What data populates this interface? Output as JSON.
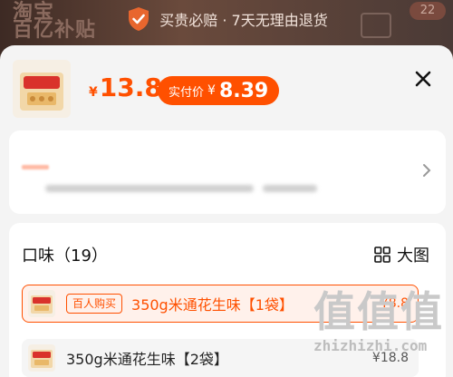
{
  "background": {
    "logo_line1": "淘宝",
    "logo_line2": "百亿补贴",
    "cart_badge": "22"
  },
  "banner": {
    "text": "买贵必赔 · 7天无理由退货",
    "icon": "shield-check-icon"
  },
  "product": {
    "currency": "¥",
    "price": "13.8",
    "actual_label": "实付价",
    "actual_currency": "¥",
    "actual_price": "8.39"
  },
  "sku": {
    "title": "口味（19）",
    "big_view_label": "大图",
    "options": [
      {
        "tag": "百人购买",
        "name": "350g米通花生味【1袋】",
        "price": "¥8.8",
        "selected": true
      },
      {
        "tag": "",
        "name": "350g米通花生味【2袋】",
        "price": "¥18.8",
        "selected": false
      }
    ]
  },
  "watermark": {
    "chars": [
      "值",
      "值",
      "值"
    ],
    "url": "zhizhizhi.com"
  },
  "colors": {
    "accent": "#ff5000",
    "sheet_bg": "#f4f4f4"
  }
}
